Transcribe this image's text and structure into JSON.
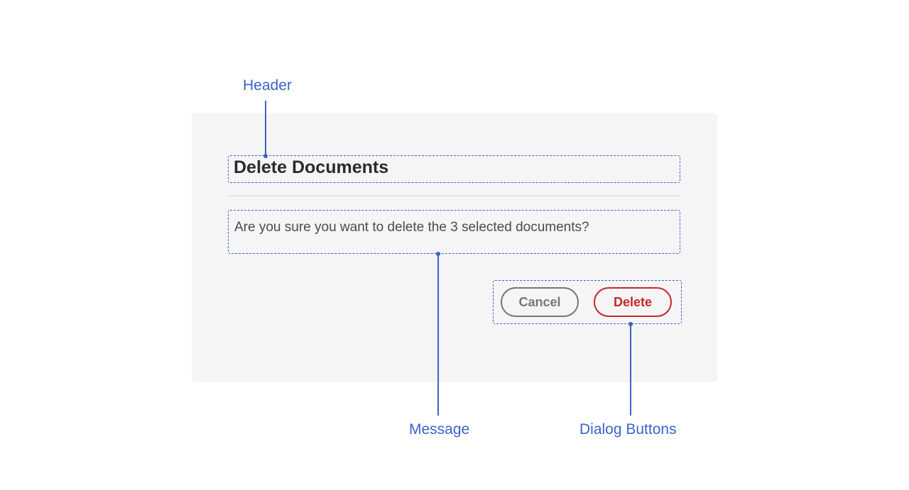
{
  "annotations": {
    "header_label": "Header",
    "message_label": "Message",
    "buttons_label": "Dialog Buttons"
  },
  "dialog": {
    "header": "Delete Documents",
    "message": "Are you sure you want to delete the 3 selected documents?",
    "buttons": {
      "cancel": "Cancel",
      "confirm": "Delete"
    }
  },
  "colors": {
    "annotation": "#3a63c9",
    "danger": "#c9252d",
    "neutral": "#767676",
    "card_bg": "#f5f5f5"
  }
}
